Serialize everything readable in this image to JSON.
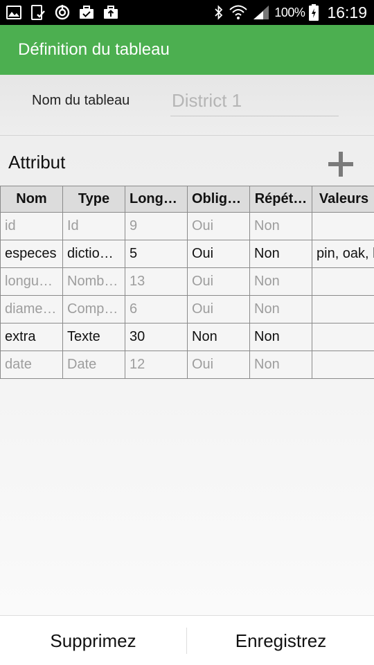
{
  "status_bar": {
    "icons_left": [
      "image-icon",
      "phone-check-icon",
      "sync-icon",
      "briefcase-check-icon",
      "briefcase-upload-icon"
    ],
    "icons_right": [
      "bluetooth-icon",
      "wifi-icon",
      "cell-signal-icon",
      "battery-charging-icon"
    ],
    "battery": "100%",
    "time": "16:19"
  },
  "app_bar": {
    "title": "Définition du tableau"
  },
  "table_name": {
    "label": "Nom du tableau",
    "value": "",
    "placeholder": "District 1"
  },
  "attributes": {
    "label": "Attribut",
    "add_icon": "plus-icon",
    "columns": [
      "Nom",
      "Type",
      "Longu…",
      "Obliga…",
      "Répét…",
      "Valeurs"
    ],
    "rows": [
      {
        "name": "id",
        "type": "Id",
        "length": "9",
        "required": "Oui",
        "repeated": "Non",
        "values": "",
        "editable": false
      },
      {
        "name": "especes",
        "type": "diction…",
        "length": "5",
        "required": "Oui",
        "repeated": "Non",
        "values": "pin, oak, b",
        "editable": true
      },
      {
        "name": "longue…",
        "type": "Nombr…",
        "length": "13",
        "required": "Oui",
        "repeated": "Non",
        "values": "",
        "editable": false
      },
      {
        "name": "diamet…",
        "type": "Comp…",
        "length": "6",
        "required": "Oui",
        "repeated": "Non",
        "values": "",
        "editable": false
      },
      {
        "name": "extra",
        "type": "Texte",
        "length": "30",
        "required": "Non",
        "repeated": "Non",
        "values": "",
        "editable": true
      },
      {
        "name": "date",
        "type": "Date",
        "length": "12",
        "required": "Oui",
        "repeated": "Non",
        "values": "",
        "editable": false
      }
    ]
  },
  "bottom_bar": {
    "delete_label": "Supprimez",
    "save_label": "Enregistrez"
  },
  "colors": {
    "app_bar": "#4caf50",
    "status_bar": "#000000",
    "header_cell": "#dcdcdc",
    "readonly_text": "#9d9d9d"
  }
}
